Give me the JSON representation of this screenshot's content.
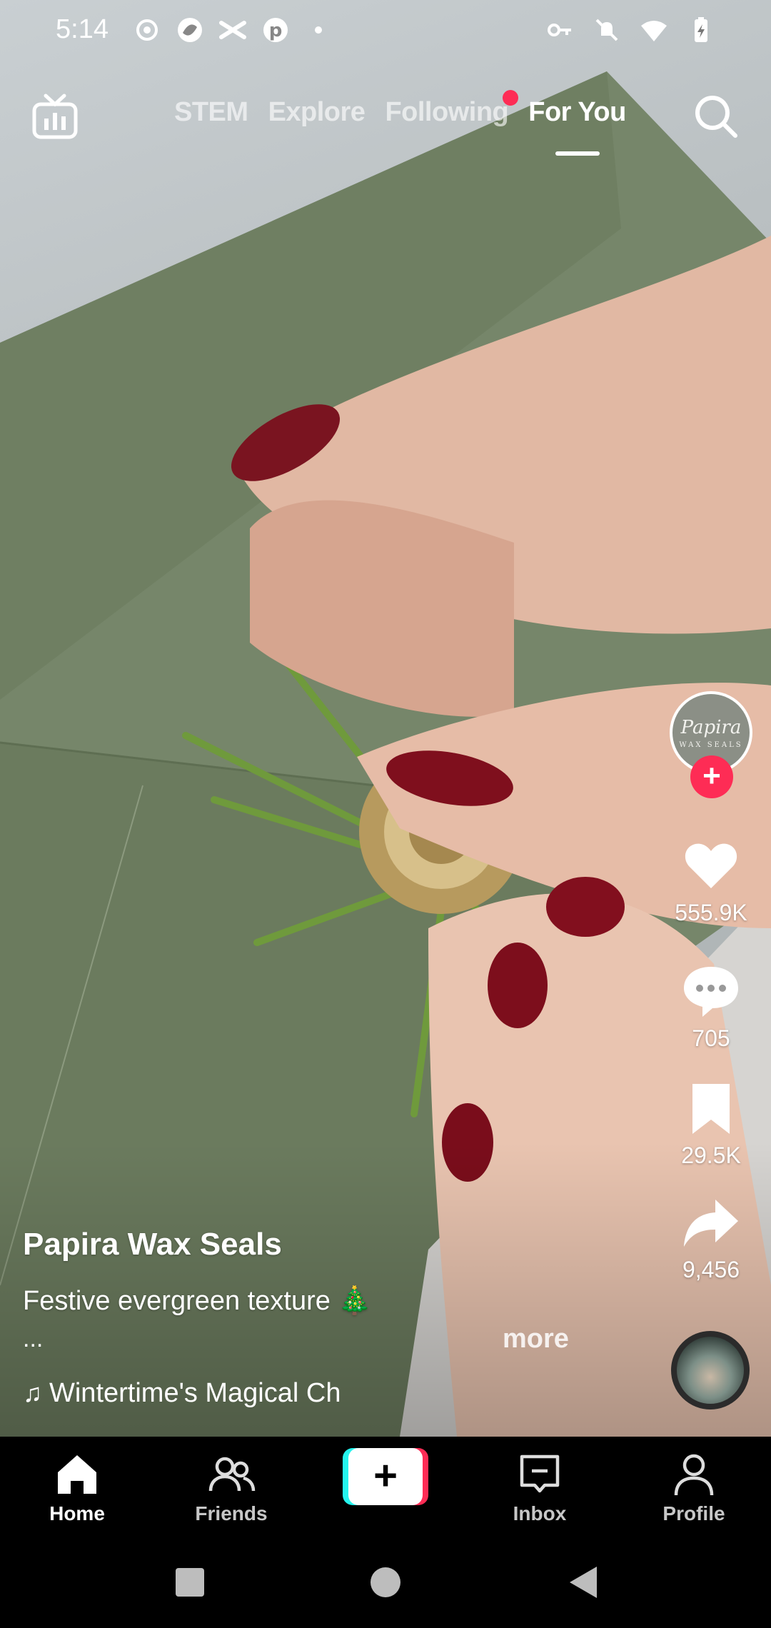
{
  "status_bar": {
    "time": "5:14",
    "left_icons": [
      "record-icon",
      "app-icon",
      "capcut-icon",
      "pinterest-icon",
      "dot-icon"
    ],
    "right_icons": [
      "key-icon",
      "mute-icon",
      "wifi-icon",
      "battery-icon"
    ]
  },
  "top_nav": {
    "live_icon": "tv-icon",
    "tabs": [
      {
        "label": "STEM",
        "active": false
      },
      {
        "label": "Explore",
        "active": false
      },
      {
        "label": "Following",
        "active": false,
        "has_dot": true
      },
      {
        "label": "For You",
        "active": true
      }
    ],
    "search_icon": "search-icon"
  },
  "right_rail": {
    "avatar_text": "Papira",
    "avatar_sub": "WAX SEALS",
    "follow_symbol": "+",
    "likes": "555.9K",
    "comments": "705",
    "saves": "29.5K",
    "shares": "9,456"
  },
  "post": {
    "creator": "Papira Wax Seals",
    "caption": "Festive evergreen texture 🎄",
    "ellipsis": "...",
    "more_label": "more",
    "sound": "Wintertime's Magical Ch",
    "note_symbol": "♫"
  },
  "bottom_nav": {
    "items": [
      {
        "label": "Home",
        "active": true
      },
      {
        "label": "Friends",
        "active": false
      },
      {
        "label": "Inbox",
        "active": false
      },
      {
        "label": "Profile",
        "active": false
      }
    ],
    "create_symbol": "+"
  },
  "colors": {
    "accent": "#fe2c55",
    "cyan": "#25f4ee",
    "envelope": "#7b8a6b"
  }
}
